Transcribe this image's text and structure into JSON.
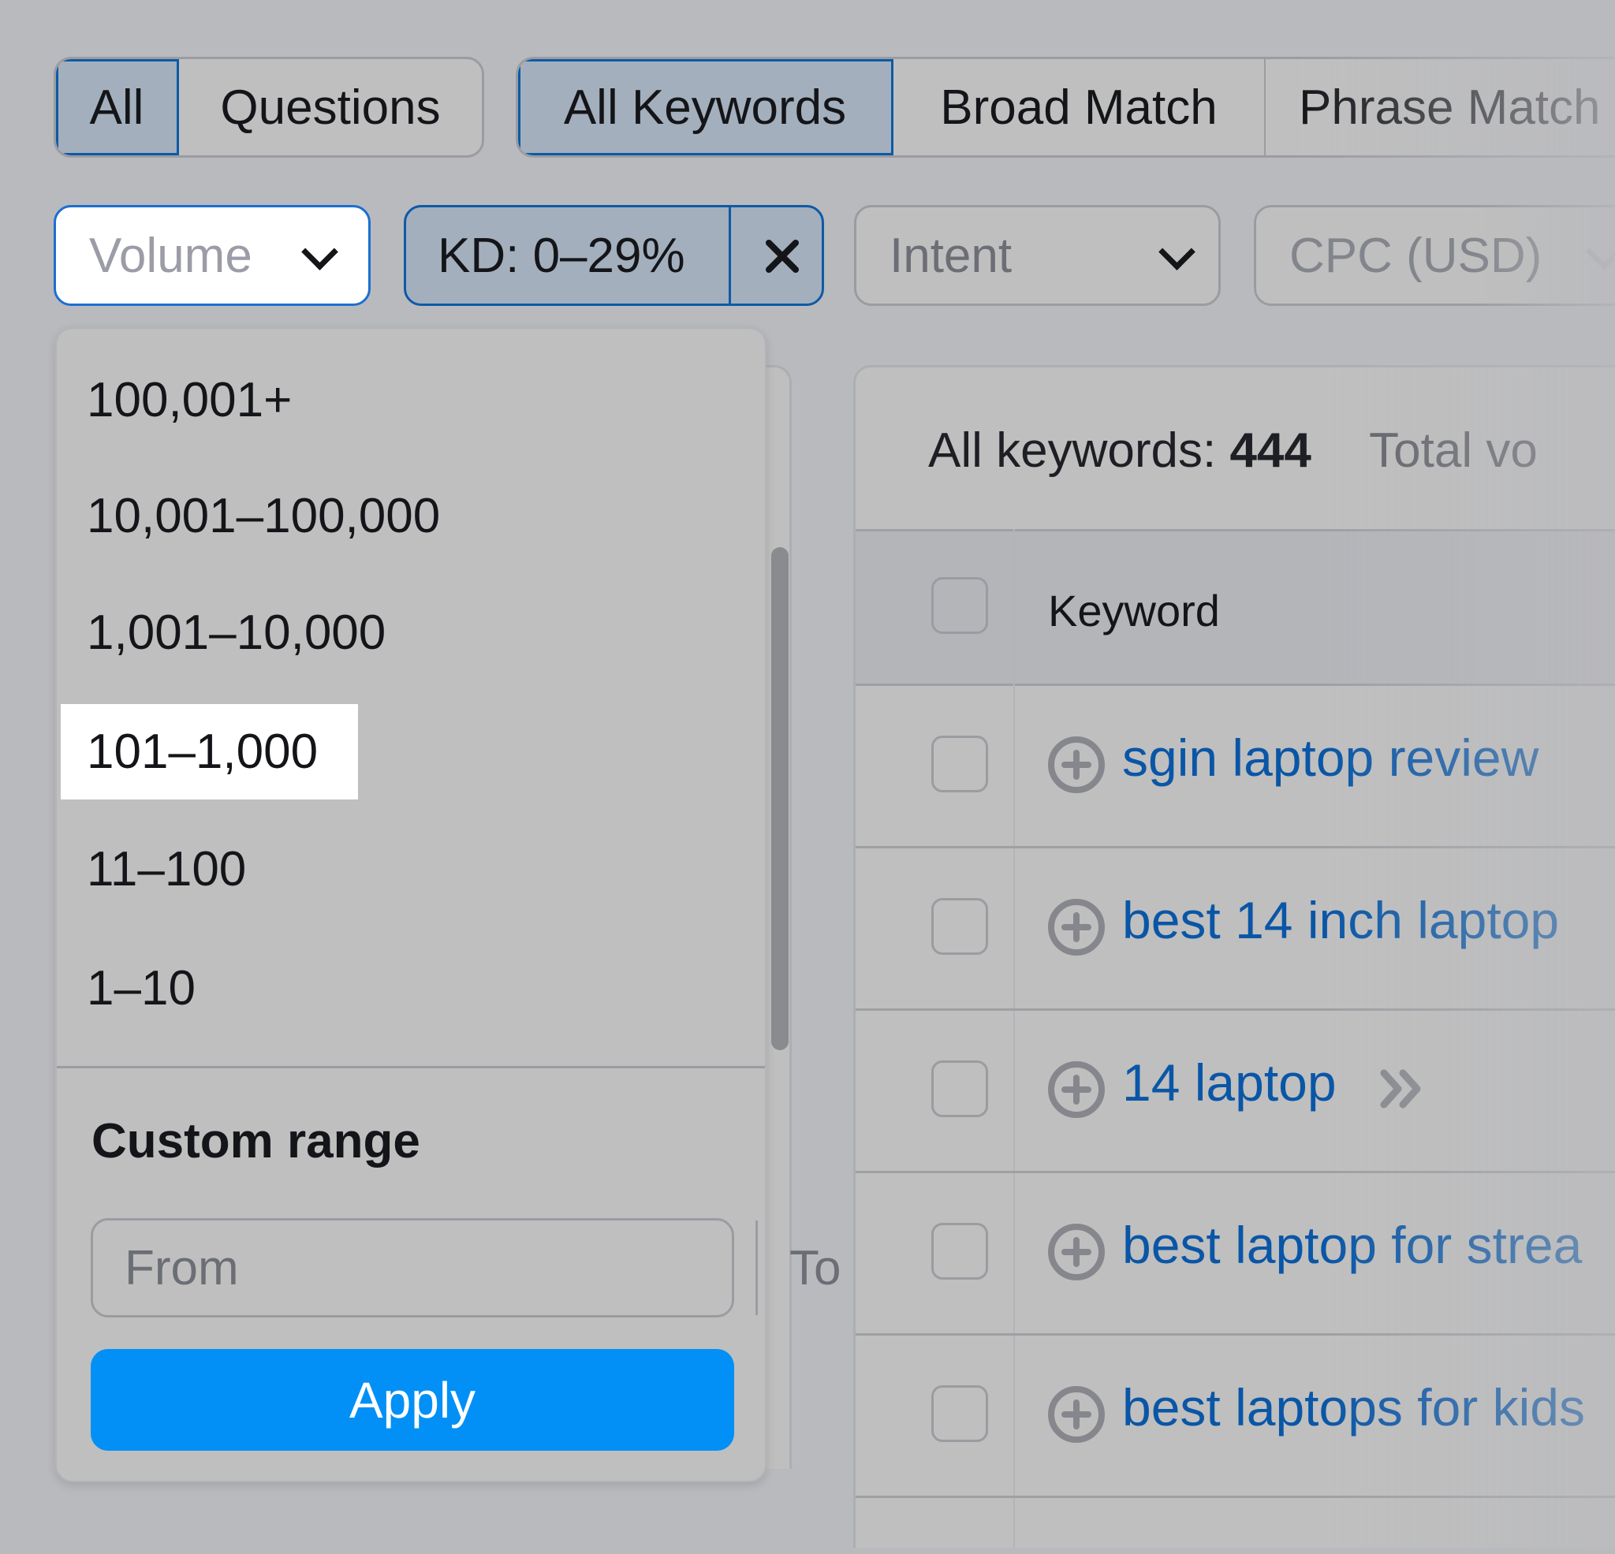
{
  "tabs_group_1": {
    "items": [
      {
        "label": "All",
        "active": true
      },
      {
        "label": "Questions",
        "active": false
      }
    ]
  },
  "tabs_group_2": {
    "items": [
      {
        "label": "All Keywords",
        "active": true
      },
      {
        "label": "Broad Match",
        "active": false
      },
      {
        "label": "Phrase Match",
        "active": false
      }
    ]
  },
  "filters": {
    "volume": {
      "label": "Volume",
      "icon": "chevron-down-icon",
      "open": true
    },
    "kd": {
      "label": "KD: 0–29%",
      "clear_icon": "close-icon"
    },
    "intent": {
      "label": "Intent",
      "icon": "chevron-down-icon"
    },
    "cpc": {
      "label": "CPC (USD)",
      "icon": "chevron-down-icon"
    }
  },
  "volume_dropdown": {
    "options": [
      {
        "label": "100,001+",
        "highlighted": false
      },
      {
        "label": "10,001–100,000",
        "highlighted": false
      },
      {
        "label": "1,001–10,000",
        "highlighted": false
      },
      {
        "label": "101–1,000",
        "highlighted": true
      },
      {
        "label": "11–100",
        "highlighted": false
      },
      {
        "label": "1–10",
        "highlighted": false
      }
    ],
    "custom_range": {
      "title": "Custom range",
      "from_placeholder": "From",
      "to_placeholder": "To",
      "from_value": "",
      "to_value": "",
      "apply_label": "Apply"
    }
  },
  "results": {
    "summary_label": "All keywords:",
    "summary_count": "444",
    "total_volume_label": "Total vo",
    "table": {
      "columns": [
        "Keyword"
      ],
      "rows": [
        {
          "keyword": "sgin laptop review",
          "has_link_icon": false
        },
        {
          "keyword": "best 14 inch laptop",
          "has_link_icon": false
        },
        {
          "keyword": "14 laptop",
          "has_link_icon": true
        },
        {
          "keyword": "best laptop for strea",
          "has_link_icon": false
        },
        {
          "keyword": "best laptops for kids",
          "has_link_icon": false
        }
      ]
    }
  },
  "colors": {
    "accent_blue": "#0290f6",
    "active_border": "#0d5aa7",
    "keyword_link": "#0a56a6",
    "highlight": "#ffffff"
  }
}
